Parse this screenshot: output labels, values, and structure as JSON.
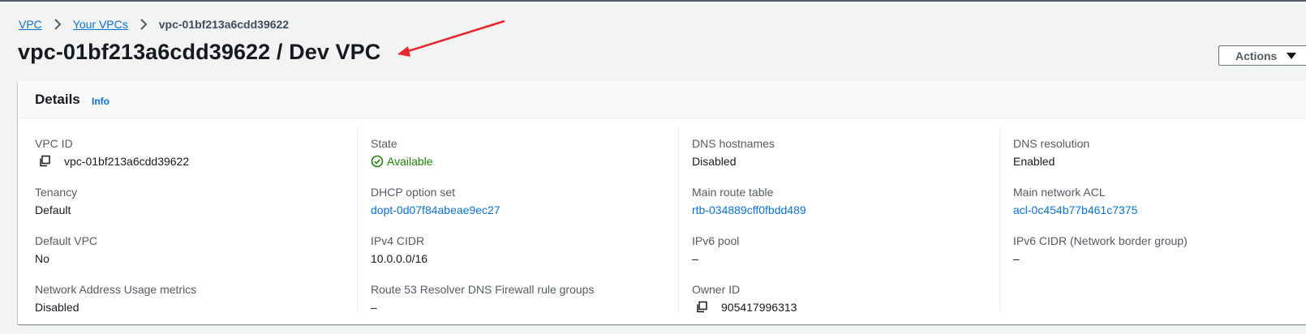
{
  "breadcrumb": {
    "items": [
      "VPC",
      "Your VPCs"
    ],
    "current": "vpc-01bf213a6cdd39622"
  },
  "page": {
    "title": "vpc-01bf213a6cdd39622 / Dev VPC"
  },
  "actions": {
    "label": "Actions"
  },
  "details": {
    "title": "Details",
    "info": "Info",
    "columns": [
      [
        {
          "label": "VPC ID",
          "value": "vpc-01bf213a6cdd39622",
          "icon": "copy-icon"
        },
        {
          "label": "Tenancy",
          "value": "Default"
        },
        {
          "label": "Default VPC",
          "value": "No"
        },
        {
          "label": "Network Address Usage metrics",
          "value": "Disabled"
        }
      ],
      [
        {
          "label": "State",
          "value": "Available",
          "icon": "check-circle-icon"
        },
        {
          "label": "DHCP option set",
          "value": "dopt-0d07f84abeae9ec27"
        },
        {
          "label": "IPv4 CIDR",
          "value": "10.0.0.0/16"
        },
        {
          "label": "Route 53 Resolver DNS Firewall rule groups",
          "value": "–"
        }
      ],
      [
        {
          "label": "DNS hostnames",
          "value": "Disabled"
        },
        {
          "label": "Main route table",
          "value": "rtb-034889cff0fbdd489"
        },
        {
          "label": "IPv6 pool",
          "value": "–"
        },
        {
          "label": "Owner ID",
          "value": "905417996313",
          "icon": "copy-icon"
        }
      ],
      [
        {
          "label": "DNS resolution",
          "value": "Enabled"
        },
        {
          "label": "Main network ACL",
          "value": "acl-0c454b77b461c7375"
        },
        {
          "label": "IPv6 CIDR (Network border group)",
          "value": "–"
        }
      ]
    ]
  },
  "colors": {
    "link": "#0972d3",
    "success": "#1d8102",
    "annotation_arrow": "#e8262b"
  }
}
